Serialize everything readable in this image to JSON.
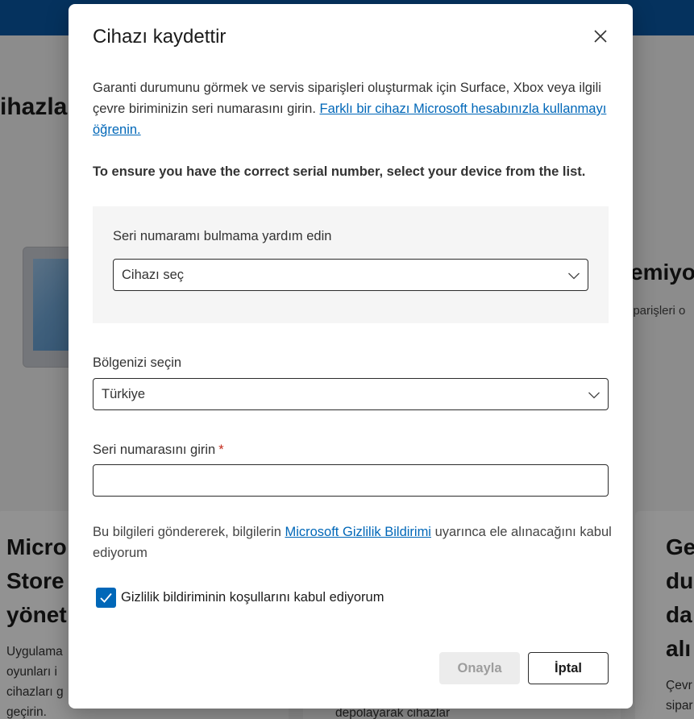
{
  "background": {
    "heading": "ihazlar",
    "right_heading": "emiyo",
    "right_sub": "iparişleri o",
    "card_left": {
      "title": "Micro\nStore\nyönet",
      "body": "Uygulama\noyunları i\ncihazları g\ngeçirin."
    },
    "card_mid": {
      "body": "depolayarak cihazlar"
    },
    "card_right": {
      "title": "Ge\ndu\nda\nalı",
      "body": "Çevr\nsipar"
    }
  },
  "dialog": {
    "title": "Cihazı kaydettir",
    "close_icon": "close-icon",
    "intro_text": "Garanti durumunu görmek ve servis siparişleri oluşturmak için Surface, Xbox veya ilgili çevre biriminizin seri numarasını girin. ",
    "intro_link": "Farklı bir cihazı Microsoft hesabınızla kullanmayı öğrenin.",
    "bold_note": "To ensure you have the correct serial number, select your device from the list.",
    "finder": {
      "label": "Seri numaramı bulmama yardım edin",
      "select_value": "Cihazı seç"
    },
    "region": {
      "label": "Bölgenizi seçin",
      "value": "Türkiye"
    },
    "serial": {
      "label": "Seri numarasını girin",
      "required_mark": "*",
      "value": ""
    },
    "privacy": {
      "before": "Bu bilgileri göndererek, bilgilerin ",
      "link": "Microsoft Gizlilik Bildirimi",
      "after": " uyarınca ele alınacağını kabul ediyorum"
    },
    "consent": {
      "label": "Gizlilik bildiriminin koşullarını kabul ediyorum",
      "checked": true
    },
    "buttons": {
      "confirm": "Onayla",
      "cancel": "İptal"
    }
  },
  "colors": {
    "accent": "#0067b8",
    "topbar": "#0a57a3",
    "required": "#c42b1c"
  }
}
